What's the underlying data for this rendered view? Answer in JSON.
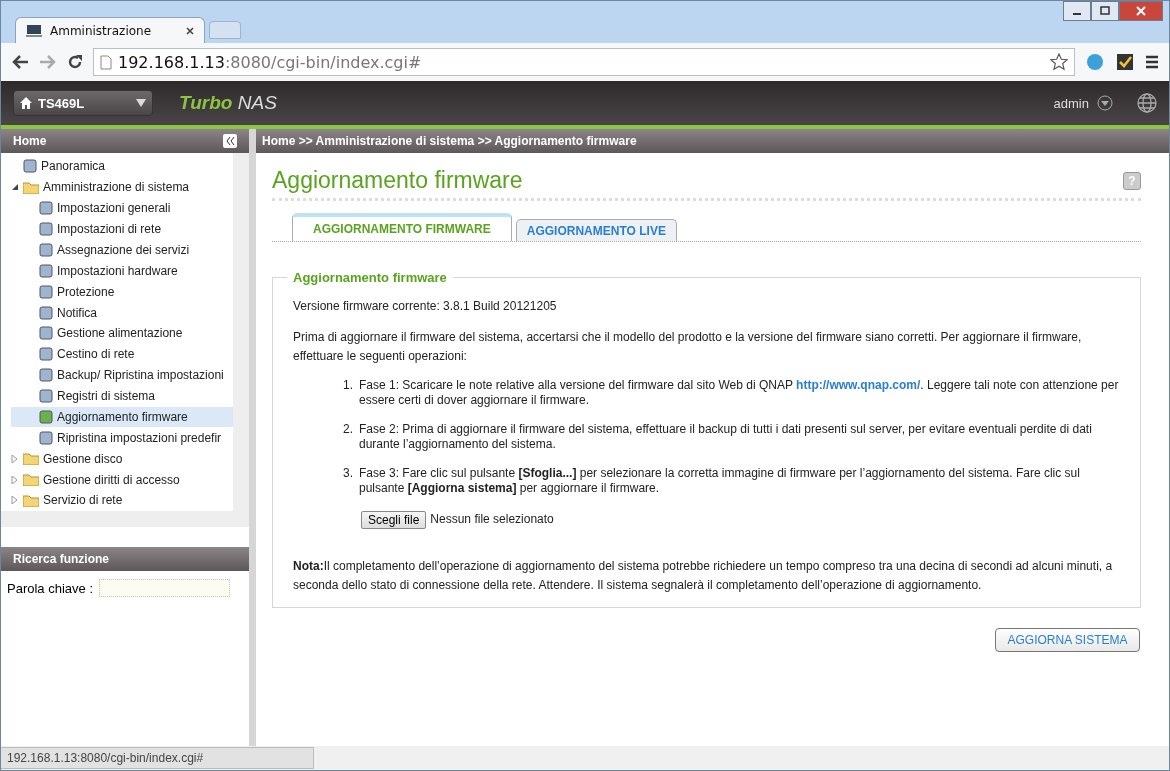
{
  "browser": {
    "tab": {
      "title": "Amministrazione",
      "selected": true
    },
    "address": {
      "host": "192.168.1.13",
      "path": ":8080/cgi-bin/index.cgi#"
    },
    "status": "192.168.1.13:8080/cgi-bin/index.cgi#"
  },
  "header": {
    "device": "TS469L",
    "brand_bold": "Turbo",
    "brand_rest": "NAS",
    "user": "admin"
  },
  "sidebar": {
    "title": "Home",
    "items": [
      {
        "label": "Panoramica",
        "kind": "page",
        "selected": false
      },
      {
        "label": "Amministrazione di sistema",
        "kind": "folder",
        "expanded": true,
        "children": [
          {
            "label": "Impostazioni generali",
            "kind": "page",
            "selected": false
          },
          {
            "label": "Impostazioni di rete",
            "kind": "page",
            "selected": false
          },
          {
            "label": "Assegnazione dei servizi",
            "kind": "page",
            "selected": false
          },
          {
            "label": "Impostazioni hardware",
            "kind": "page",
            "selected": false
          },
          {
            "label": "Protezione",
            "kind": "page",
            "selected": false
          },
          {
            "label": "Notifica",
            "kind": "page",
            "selected": false
          },
          {
            "label": "Gestione alimentazione",
            "kind": "page",
            "selected": false
          },
          {
            "label": "Cestino di rete",
            "kind": "page",
            "selected": false
          },
          {
            "label": "Backup/ Ripristina impostazioni",
            "kind": "page",
            "selected": false
          },
          {
            "label": "Registri di sistema",
            "kind": "page",
            "selected": false
          },
          {
            "label": "Aggiornamento firmware",
            "kind": "page",
            "selected": true
          },
          {
            "label": "Ripristina impostazioni predefir",
            "kind": "page",
            "selected": false
          }
        ]
      },
      {
        "label": "Gestione disco",
        "kind": "folder",
        "expanded": false
      },
      {
        "label": "Gestione diritti di accesso",
        "kind": "folder",
        "expanded": false
      },
      {
        "label": "Servizio di rete",
        "kind": "folder",
        "expanded": false
      }
    ],
    "search": {
      "title": "Ricerca funzione",
      "label": "Parola chiave :"
    }
  },
  "breadcrumb": "Home >> Amministrazione di sistema >> Aggiornamento firmware",
  "page": {
    "title": "Aggiornamento firmware",
    "help": "?",
    "tabs": [
      {
        "label": "AGGIORNAMENTO FIRMWARE",
        "selected": true
      },
      {
        "label": "AGGIORNAMENTO LIVE",
        "selected": false
      }
    ],
    "section": {
      "legend": "Aggiornamento firmware",
      "version": "Versione firmware corrente: 3.8.1 Build 20121205",
      "intro": "Prima di aggiornare il firmware del sistema, accertarsi che il modello del prodotto e la versione del firmware siano corretti. Per aggiornare il firmware, effettuare le seguenti operazioni:",
      "steps": [
        {
          "number": "1.",
          "parts": [
            {
              "kind": "text",
              "text": "Fase 1: Scaricare le note relative alla versione del firmware dal sito Web di QNAP "
            },
            {
              "kind": "link",
              "text": "http://www.qnap.com/"
            },
            {
              "kind": "text",
              "text": ". Leggere tali note con attenzione per essere certi di dover aggiornare il firmware."
            }
          ]
        },
        {
          "number": "2.",
          "parts": [
            {
              "kind": "text",
              "text": "Fase 2: Prima di aggiornare il firmware del sistema, effettuare il backup di tutti i dati presenti sul server, per evitare eventuali perdite di dati durante l’aggiornamento del sistema."
            }
          ]
        },
        {
          "number": "3.",
          "parts": [
            {
              "kind": "text",
              "text": "Fase 3: Fare clic sul pulsante **[Sfoglia...]** per selezionare la corretta immagine di firmware per l’aggiornamento del sistema. Fare clic sul pulsante **[Aggiorna sistema]** per aggiornare il firmware."
            }
          ]
        }
      ],
      "file_button": "Scegli file",
      "file_status": "Nessun file selezionato",
      "note": "**Nota:**Il completamento dell’operazione di aggiornamento del sistema potrebbe richiedere un tempo compreso tra una decina di secondi ad alcuni minuti, a seconda dello stato di connessione della rete. Attendere. Il sistema segnalerà il completamento dell’operazione di aggiornamento."
    },
    "submit": "AGGIORNA SISTEMA"
  }
}
